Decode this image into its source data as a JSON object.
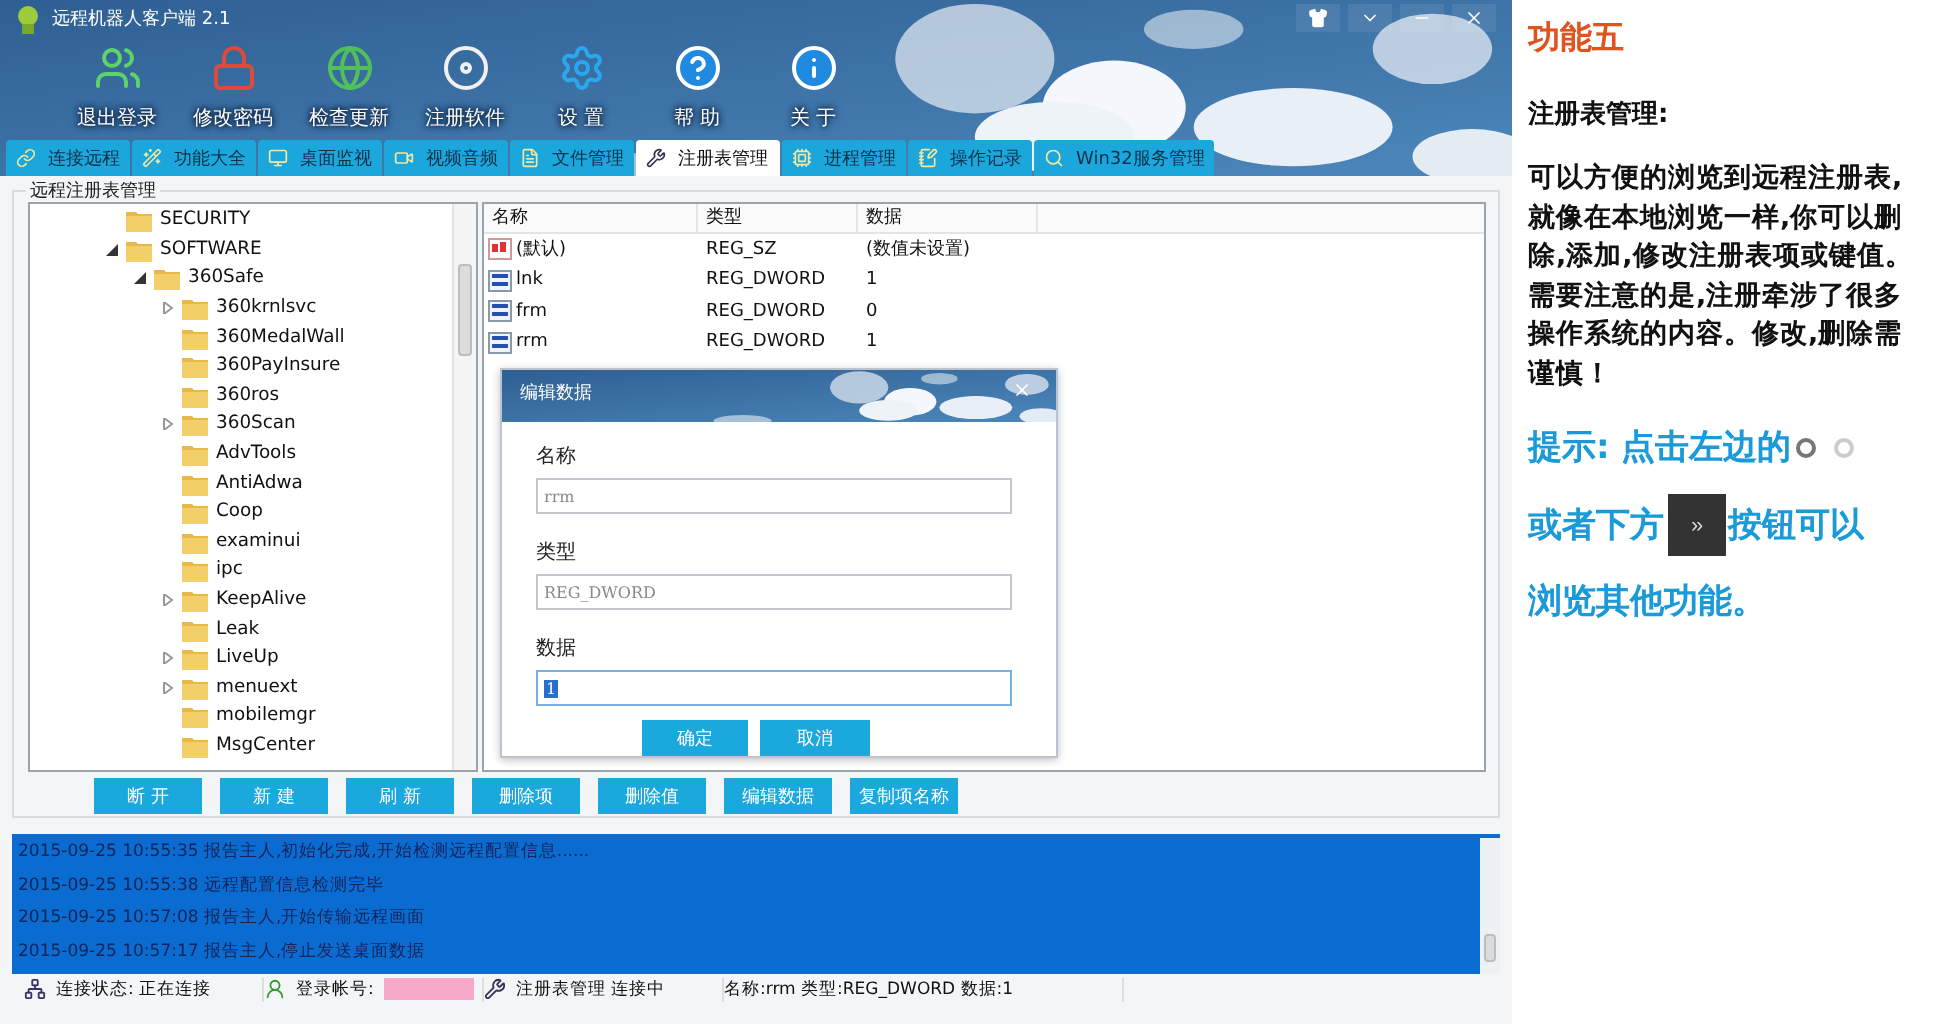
{
  "window": {
    "title": "远程机器人客户端 2.1"
  },
  "toolbar": [
    {
      "label": "退出登录"
    },
    {
      "label": "修改密码"
    },
    {
      "label": "检查更新"
    },
    {
      "label": "注册软件"
    },
    {
      "label": "设 置"
    },
    {
      "label": "帮 助"
    },
    {
      "label": "关 于"
    }
  ],
  "tabs": [
    {
      "label": "连接远程",
      "selected": false
    },
    {
      "label": "功能大全",
      "selected": false
    },
    {
      "label": "桌面监视",
      "selected": false
    },
    {
      "label": "视频音频",
      "selected": false
    },
    {
      "label": "文件管理",
      "selected": false
    },
    {
      "label": "注册表管理",
      "selected": true
    },
    {
      "label": "进程管理",
      "selected": false
    },
    {
      "label": "操作记录",
      "selected": false
    },
    {
      "label": "Win32服务管理",
      "selected": false
    }
  ],
  "group_title": "远程注册表管理",
  "tree": [
    {
      "label": "SECURITY"
    },
    {
      "label": "SOFTWARE",
      "expanded": true,
      "children": [
        {
          "label": "360Safe",
          "expanded": true,
          "children": [
            {
              "label": "360krnlsvc",
              "expanded": false
            },
            {
              "label": "360MedalWall"
            },
            {
              "label": "360PayInsure"
            },
            {
              "label": "360ros"
            },
            {
              "label": "360Scan",
              "expanded": false
            },
            {
              "label": "AdvTools"
            },
            {
              "label": "AntiAdwa"
            },
            {
              "label": "Coop"
            },
            {
              "label": "examinui"
            },
            {
              "label": "ipc"
            },
            {
              "label": "KeepAlive",
              "expanded": false
            },
            {
              "label": "Leak"
            },
            {
              "label": "LiveUp",
              "expanded": false
            },
            {
              "label": "menuext",
              "expanded": false
            },
            {
              "label": "mobilemgr"
            },
            {
              "label": "MsgCenter"
            }
          ]
        }
      ]
    }
  ],
  "table": {
    "columns": [
      "名称",
      "类型",
      "数据"
    ],
    "rows": [
      {
        "kind": "string",
        "name": "(默认)",
        "type": "REG_SZ",
        "data": "(数值未设置)"
      },
      {
        "kind": "number",
        "name": "lnk",
        "type": "REG_DWORD",
        "data": "1"
      },
      {
        "kind": "number",
        "name": "frm",
        "type": "REG_DWORD",
        "data": "0"
      },
      {
        "kind": "number",
        "name": "rrm",
        "type": "REG_DWORD",
        "data": "1"
      }
    ]
  },
  "dialog": {
    "title": "编辑数据",
    "fields": [
      {
        "label": "名称",
        "value": "rrm",
        "focused": false
      },
      {
        "label": "类型",
        "value": "REG_DWORD",
        "focused": false
      },
      {
        "label": "数据",
        "value": "1",
        "focused": true
      }
    ],
    "buttons": [
      "确定",
      "取消"
    ]
  },
  "actions": [
    "断 开",
    "新 建",
    "刷 新",
    "删除项",
    "删除值",
    "编辑数据",
    "复制项名称"
  ],
  "log": [
    "2015-09-25 10:55:35 报告主人,初始化完成,开始检测远程配置信息......",
    "2015-09-25 10:55:38 远程配置信息检测完毕",
    "2015-09-25 10:57:08 报告主人,开始传输远程画面",
    "2015-09-25 10:57:17 报告主人,停止发送桌面数据"
  ],
  "status_bar": [
    {
      "text": "连接状态: 正在连接",
      "redacted": false
    },
    {
      "text": "登录帐号:",
      "redacted": true
    },
    {
      "text": "注册表管理 连接中",
      "redacted": false
    },
    {
      "text": "名称:rrm 类型:REG_DWORD 数据:1",
      "redacted": false
    }
  ],
  "aside": {
    "heading": "功能五",
    "subtitle": "注册表管理:",
    "body": "可以方便的浏览到远程注册表,就像在本地浏览一样,你可以删除,添加,修改注册表项或键值。需要注意的是,注册牵涉了很多操作系统的内容。修改,删除需谨慎！",
    "hint": {
      "parts": [
        "提示: 点击左边的",
        "或者下方",
        "按钮可以",
        "浏览其他功能。"
      ],
      "dots": [
        {
          "selected": true
        },
        {
          "selected": false
        }
      ],
      "button": "»"
    }
  }
}
